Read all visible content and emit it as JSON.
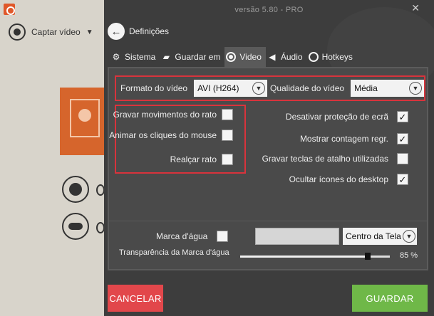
{
  "app": {
    "capture_label": "Captar vídeo"
  },
  "dialog": {
    "version": "versão 5.80 - PRO",
    "close_glyph": "✕",
    "header_title": "Definições",
    "tabs": [
      {
        "label": "Sistema",
        "icon": "gear-icon",
        "active": false
      },
      {
        "label": "Guardar em",
        "icon": "folder-icon",
        "active": false
      },
      {
        "label": "Video",
        "icon": "record-icon",
        "active": true
      },
      {
        "label": "Áudio",
        "icon": "speaker-icon",
        "active": false
      },
      {
        "label": "Hotkeys",
        "icon": "hotkey-icon",
        "active": false
      }
    ]
  },
  "video": {
    "format_label": "Formato do vídeo",
    "format_value": "AVI (H264)",
    "quality_label": "Qualidade do vídeo",
    "quality_value": "Média",
    "mouse_options": [
      {
        "label": "Gravar movimentos do rato",
        "checked": false
      },
      {
        "label": "Animar os cliques do mouse",
        "checked": false
      },
      {
        "label": "Realçar rato",
        "checked": false
      }
    ],
    "other_options": [
      {
        "label": "Desativar proteção de ecrã",
        "checked": true
      },
      {
        "label": "Mostrar contagem regr.",
        "checked": true
      },
      {
        "label": "Gravar teclas de atalho utilizadas",
        "checked": false
      },
      {
        "label": "Ocultar ícones do desktop",
        "checked": true
      }
    ],
    "watermark_label": "Marca d'água",
    "watermark_checked": false,
    "watermark_text": "",
    "watermark_position": "Centro da Tela",
    "transparency_label": "Transparência da Marca d'água",
    "transparency_value": 85,
    "transparency_text": "85 %"
  },
  "buttons": {
    "cancel": "CANCELAR",
    "save": "GUARDAR"
  },
  "colors": {
    "dialog_bg": "#3d3d3d",
    "panel_bg": "#4a4a4a",
    "highlight_border": "#d8333c",
    "cancel": "#e2474b",
    "save": "#6fb848"
  }
}
